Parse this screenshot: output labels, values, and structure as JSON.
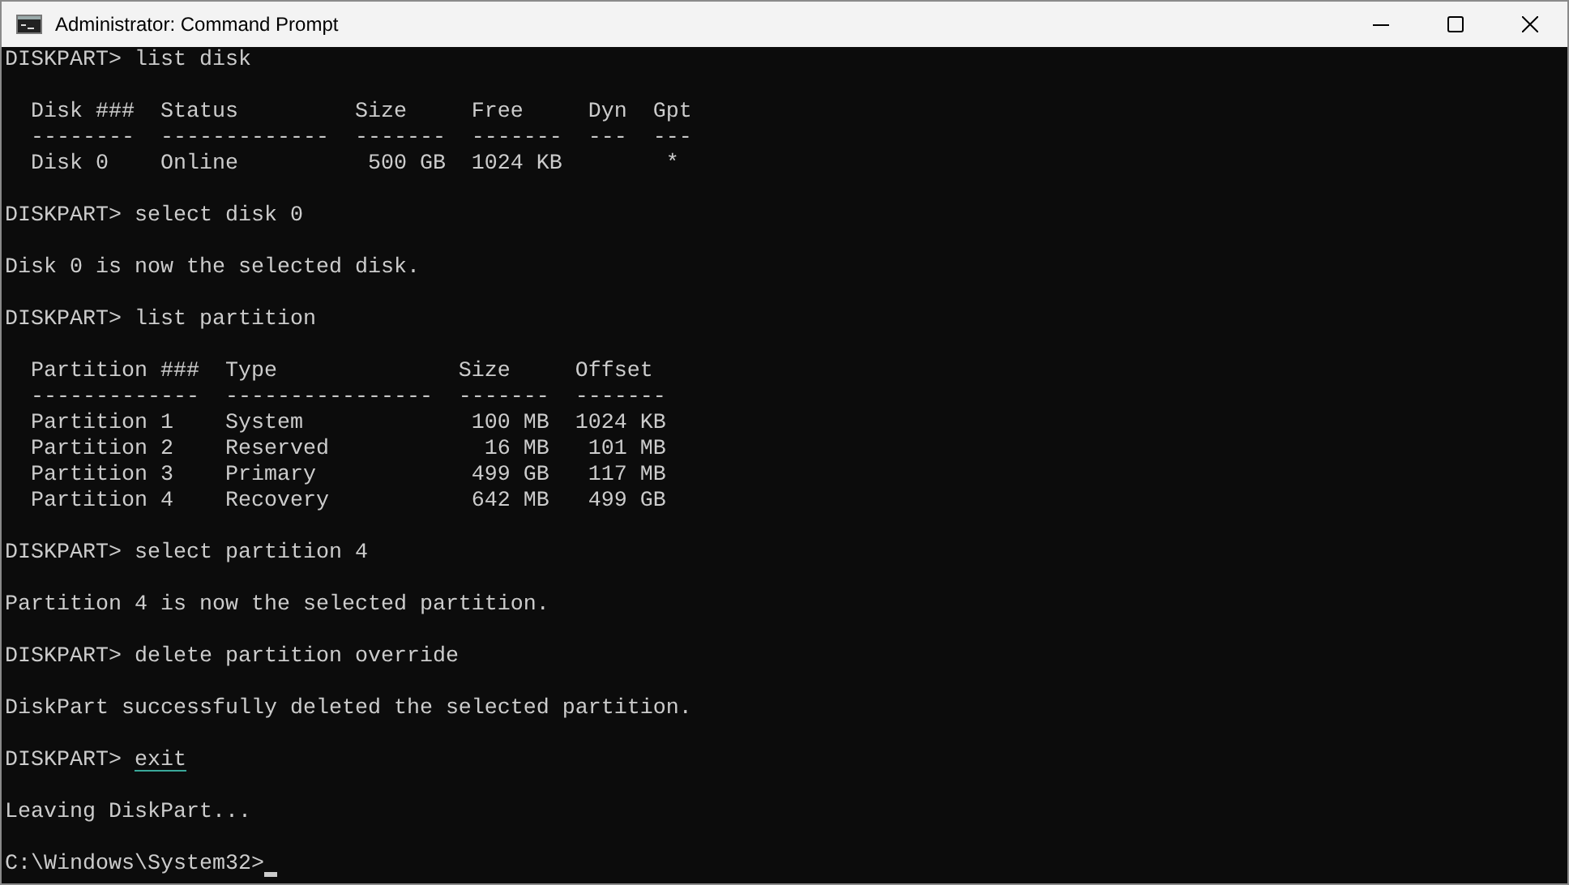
{
  "window": {
    "title": "Administrator: Command Prompt"
  },
  "console": {
    "lines": [
      {
        "kind": "prompt",
        "prompt": "DISKPART> ",
        "command": "list disk",
        "underlined": false
      },
      {
        "kind": "blank"
      },
      {
        "kind": "output",
        "text": "  Disk ###  Status         Size     Free     Dyn  Gpt"
      },
      {
        "kind": "output",
        "text": "  --------  -------------  -------  -------  ---  ---"
      },
      {
        "kind": "output",
        "text": "  Disk 0    Online          500 GB  1024 KB        *"
      },
      {
        "kind": "blank"
      },
      {
        "kind": "prompt",
        "prompt": "DISKPART> ",
        "command": "select disk 0",
        "underlined": false
      },
      {
        "kind": "blank"
      },
      {
        "kind": "output",
        "text": "Disk 0 is now the selected disk."
      },
      {
        "kind": "blank"
      },
      {
        "kind": "prompt",
        "prompt": "DISKPART> ",
        "command": "list partition",
        "underlined": false
      },
      {
        "kind": "blank"
      },
      {
        "kind": "output",
        "text": "  Partition ###  Type              Size     Offset"
      },
      {
        "kind": "output",
        "text": "  -------------  ----------------  -------  -------"
      },
      {
        "kind": "output",
        "text": "  Partition 1    System             100 MB  1024 KB"
      },
      {
        "kind": "output",
        "text": "  Partition 2    Reserved            16 MB   101 MB"
      },
      {
        "kind": "output",
        "text": "  Partition 3    Primary            499 GB   117 MB"
      },
      {
        "kind": "output",
        "text": "  Partition 4    Recovery           642 MB   499 GB"
      },
      {
        "kind": "blank"
      },
      {
        "kind": "prompt",
        "prompt": "DISKPART> ",
        "command": "select partition 4",
        "underlined": false
      },
      {
        "kind": "blank"
      },
      {
        "kind": "output",
        "text": "Partition 4 is now the selected partition."
      },
      {
        "kind": "blank"
      },
      {
        "kind": "prompt",
        "prompt": "DISKPART> ",
        "command": "delete partition override",
        "underlined": false
      },
      {
        "kind": "blank"
      },
      {
        "kind": "output",
        "text": "DiskPart successfully deleted the selected partition."
      },
      {
        "kind": "blank"
      },
      {
        "kind": "prompt",
        "prompt": "DISKPART> ",
        "command": "exit",
        "underlined": true
      },
      {
        "kind": "blank"
      },
      {
        "kind": "output",
        "text": "Leaving DiskPart..."
      },
      {
        "kind": "blank"
      },
      {
        "kind": "prompt",
        "prompt": "C:\\Windows\\System32>",
        "cursor": true
      }
    ]
  }
}
